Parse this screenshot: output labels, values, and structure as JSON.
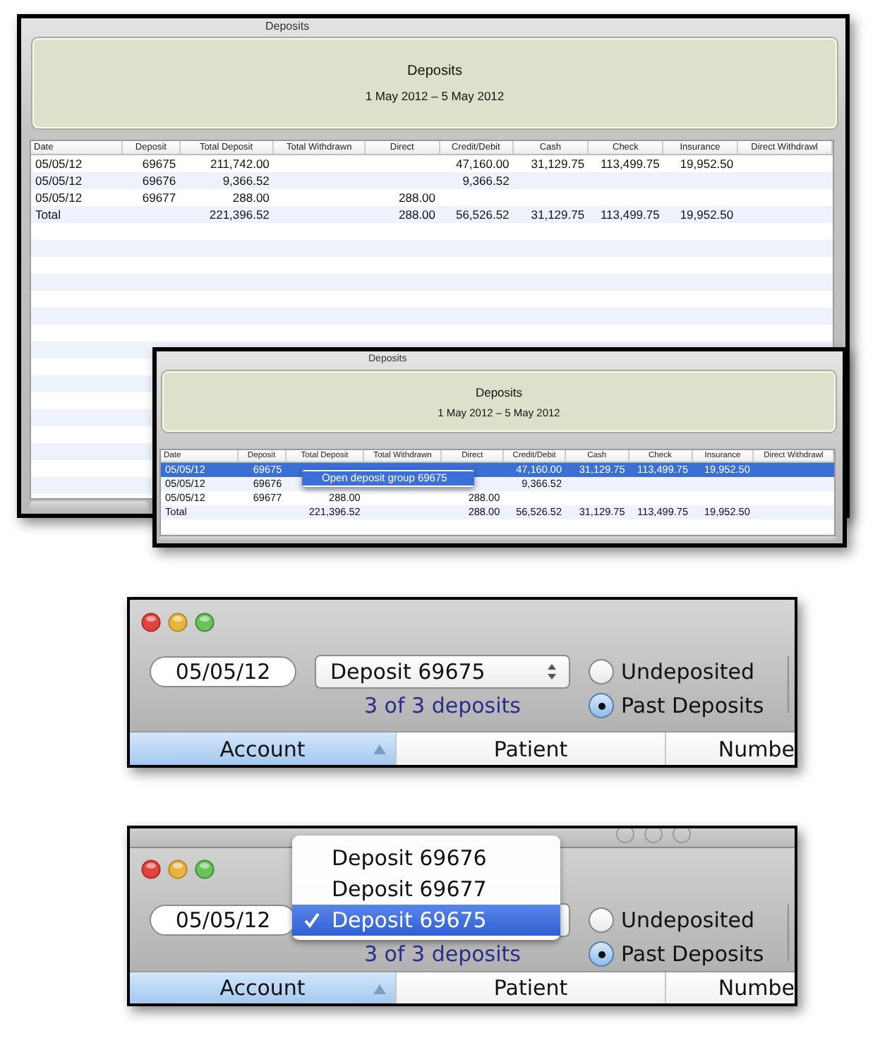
{
  "panels": [
    {
      "kind": "report",
      "window_title": "Deposits",
      "banner": {
        "title": "Deposits",
        "subtitle": "1 May 2012 – 5 May 2012"
      },
      "columns": [
        "Date",
        "Deposit",
        "Total Deposit",
        "Total Withdrawn",
        "Direct",
        "Credit/Debit",
        "Cash",
        "Check",
        "Insurance",
        "Direct Withdrawl"
      ],
      "rows": [
        {
          "selected": false,
          "cells": [
            "05/05/12",
            "69675",
            "211,742.00",
            null,
            null,
            "47,160.00",
            "31,129.75",
            "113,499.75",
            "19,952.50",
            null
          ]
        },
        {
          "selected": false,
          "cells": [
            "05/05/12",
            "69676",
            "9,366.52",
            null,
            null,
            "9,366.52",
            null,
            null,
            null,
            null
          ]
        },
        {
          "selected": false,
          "cells": [
            "05/05/12",
            "69677",
            "288.00",
            null,
            "288.00",
            null,
            null,
            null,
            null,
            null
          ]
        },
        {
          "selected": false,
          "cells": [
            "Total",
            null,
            "221,396.52",
            null,
            "288.00",
            "56,526.52",
            "31,129.75",
            "113,499.75",
            "19,952.50",
            null
          ]
        }
      ]
    },
    {
      "kind": "report",
      "window_title": "Deposits",
      "banner": {
        "title": "Deposits",
        "subtitle": "1 May 2012 – 5 May 2012"
      },
      "columns": [
        "Date",
        "Deposit",
        "Total Deposit",
        "Total Withdrawn",
        "Direct",
        "Credit/Debit",
        "Cash",
        "Check",
        "Insurance",
        "Direct Withdrawl"
      ],
      "rows": [
        {
          "selected": true,
          "cells": [
            "05/05/12",
            "69675",
            null,
            null,
            null,
            "47,160.00",
            "31,129.75",
            "113,499.75",
            "19,952.50",
            null
          ]
        },
        {
          "selected": false,
          "cells": [
            "05/05/12",
            "69676",
            null,
            null,
            null,
            "9,366.52",
            null,
            null,
            null,
            null
          ]
        },
        {
          "selected": false,
          "cells": [
            "05/05/12",
            "69677",
            "288.00",
            null,
            "288.00",
            null,
            null,
            null,
            null,
            null
          ]
        },
        {
          "selected": false,
          "cells": [
            "Total",
            null,
            "221,396.52",
            null,
            "288.00",
            "56,526.52",
            "31,129.75",
            "113,499.75",
            "19,952.50",
            null
          ]
        }
      ],
      "context_menu": {
        "items": [
          {
            "label": "Open deposit group 69675",
            "selected": true
          }
        ]
      }
    },
    {
      "kind": "toolbar",
      "date_field": {
        "value": "05/05/12"
      },
      "deposit_popup": {
        "value": "Deposit 69675"
      },
      "deposit_count": "3 of 3 deposits",
      "radios": [
        {
          "label": "Undeposited",
          "selected": false
        },
        {
          "label": "Past Deposits",
          "selected": true
        }
      ],
      "columns": [
        {
          "label": "Account",
          "selected": true,
          "sorted": true
        },
        {
          "label": "Patient",
          "selected": false,
          "sorted": false
        },
        {
          "label": "Numbe",
          "selected": false,
          "sorted": false
        }
      ]
    },
    {
      "kind": "toolbar",
      "date_field": {
        "value": "05/05/12"
      },
      "deposit_count": "3 of 3 deposits",
      "popup_menu": {
        "items": [
          {
            "label": "Deposit 69676",
            "checked": false,
            "selected": false
          },
          {
            "label": "Deposit 69677",
            "checked": false,
            "selected": false
          },
          {
            "label": "Deposit 69675",
            "checked": true,
            "selected": true
          }
        ]
      },
      "radios": [
        {
          "label": "Undeposited",
          "selected": false
        },
        {
          "label": "Past Deposits",
          "selected": true
        }
      ],
      "columns": [
        {
          "label": "Account",
          "selected": true,
          "sorted": true
        },
        {
          "label": "Patient",
          "selected": false,
          "sorted": false
        },
        {
          "label": "Numbe",
          "selected": false,
          "sorted": false
        }
      ]
    }
  ]
}
